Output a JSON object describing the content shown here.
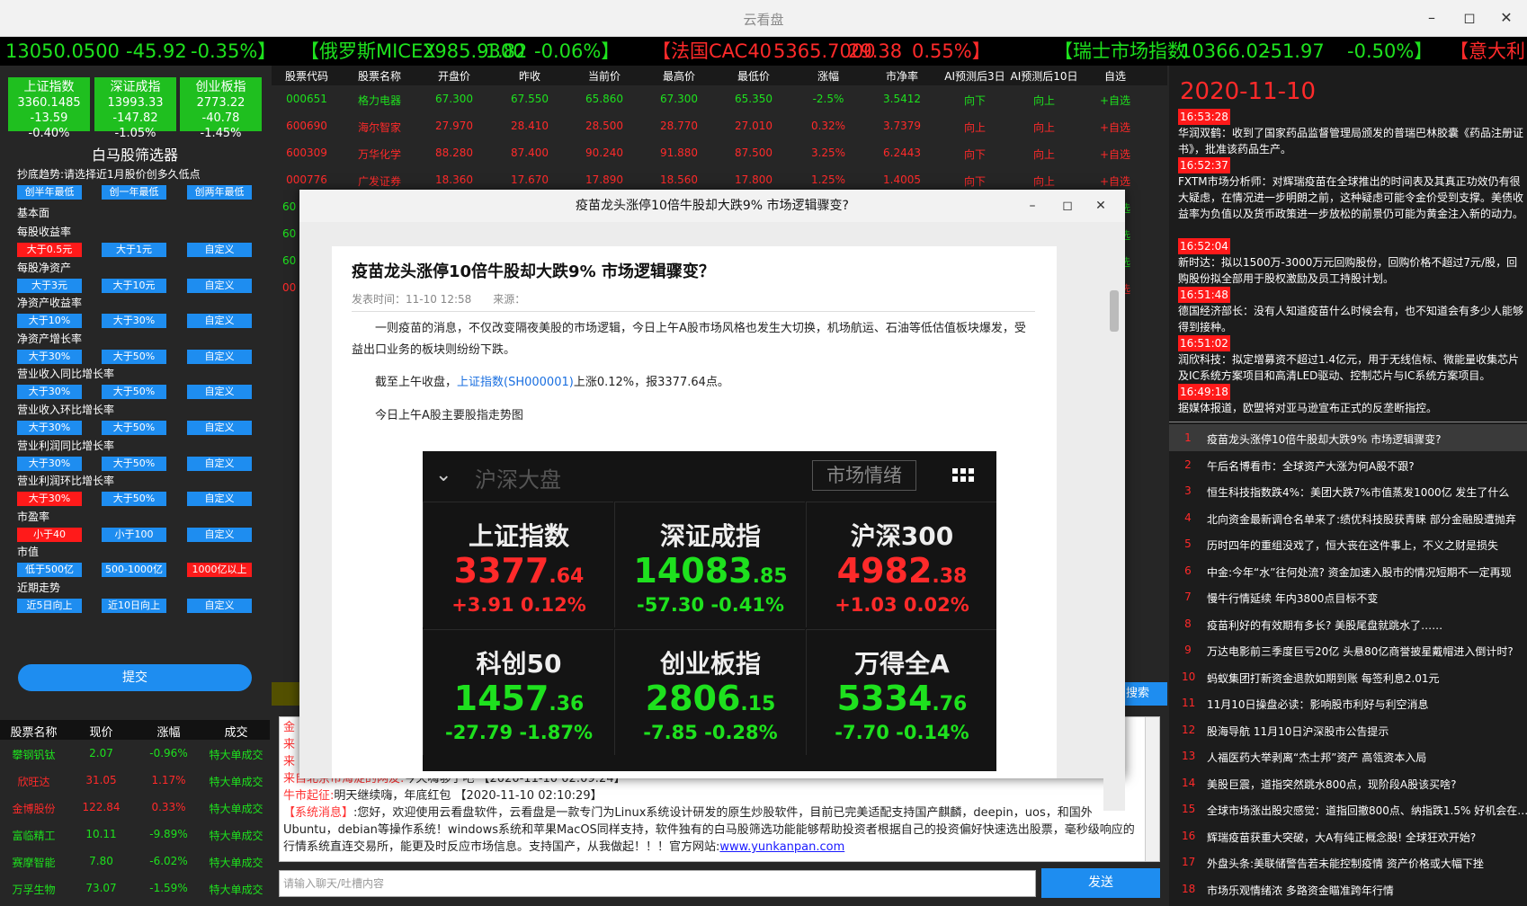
{
  "window": {
    "title": "云看盘"
  },
  "ticker": [
    {
      "text": "13050.0500",
      "color": "green"
    },
    {
      "text": "-45.92",
      "color": "green"
    },
    {
      "text": "-0.35%】",
      "color": "green"
    },
    {
      "text": "【俄罗斯MICEX",
      "color": "green"
    },
    {
      "text": "2985.9300",
      "color": "green"
    },
    {
      "text": "-1.82",
      "color": "green"
    },
    {
      "text": "-0.06%】",
      "color": "green"
    },
    {
      "text": "【法国CAC40",
      "color": "red"
    },
    {
      "text": "5365.7000",
      "color": "red"
    },
    {
      "text": "29.38",
      "color": "red"
    },
    {
      "text": "0.55%】",
      "color": "red"
    },
    {
      "text": "【瑞士市场指数",
      "color": "green"
    },
    {
      "text": "10366.02",
      "color": "green"
    },
    {
      "text": "-51.97",
      "color": "green"
    },
    {
      "text": "-0.50%】",
      "color": "green"
    },
    {
      "text": "【意大利",
      "color": "red"
    }
  ],
  "indices": [
    {
      "name": "上证指数",
      "value": "3360.1485",
      "change": "-13.59 -0.40%"
    },
    {
      "name": "深证成指",
      "value": "13993.33",
      "change": "-147.82 -1.05%"
    },
    {
      "name": "创业板指",
      "value": "2773.22",
      "change": "-40.78 -1.45%"
    }
  ],
  "screener": {
    "title": "白马股筛选器",
    "trend_label": "抄底趋势:请选择近1月股价创多久低点",
    "trend_buttons": [
      "创半年最低",
      "创一年最低",
      "创两年最低"
    ],
    "basic_label": "基本面",
    "groups": [
      {
        "label": "每股收益率",
        "buttons": [
          "大于0.5元",
          "大于1元",
          "自定义"
        ],
        "active": 0
      },
      {
        "label": "每股净资产",
        "buttons": [
          "大于3元",
          "大于10元",
          "自定义"
        ],
        "active": -1
      },
      {
        "label": "净资产收益率",
        "buttons": [
          "大于10%",
          "大于30%",
          "自定义"
        ],
        "active": -1
      },
      {
        "label": "净资产增长率",
        "buttons": [
          "大于30%",
          "大于50%",
          "自定义"
        ],
        "active": -1
      },
      {
        "label": "营业收入同比增长率",
        "buttons": [
          "大于30%",
          "大于50%",
          "自定义"
        ],
        "active": -1
      },
      {
        "label": "营业收入环比增长率",
        "buttons": [
          "大于30%",
          "大于50%",
          "自定义"
        ],
        "active": -1
      },
      {
        "label": "营业利润同比增长率",
        "buttons": [
          "大于30%",
          "大于50%",
          "自定义"
        ],
        "active": -1
      },
      {
        "label": "营业利润环比增长率",
        "buttons": [
          "大于30%",
          "大于50%",
          "自定义"
        ],
        "active": 0
      },
      {
        "label": "市盈率",
        "buttons": [
          "小于40",
          "小于100",
          "自定义"
        ],
        "active": 0
      },
      {
        "label": "市值",
        "buttons": [
          "低于500亿",
          "500-1000亿",
          "1000亿以上"
        ],
        "active": 2
      },
      {
        "label": "近期走势",
        "buttons": [
          "近5日向上",
          "近10日向上",
          "自定义"
        ],
        "active": -1
      }
    ],
    "submit": "提交"
  },
  "left_table": {
    "headers": [
      "股票名称",
      "现价",
      "涨幅",
      "成交"
    ],
    "rows": [
      {
        "name": "攀钢钒钛",
        "price": "2.07",
        "change": "-0.96%",
        "deal": "特大单成交",
        "color": "green"
      },
      {
        "name": "欣旺达",
        "price": "31.05",
        "change": "1.17%",
        "deal": "特大单成交",
        "color": "red"
      },
      {
        "name": "金博股份",
        "price": "122.84",
        "change": "0.33%",
        "deal": "特大单成交",
        "color": "red"
      },
      {
        "name": "富临精工",
        "price": "10.11",
        "change": "-9.89%",
        "deal": "特大单成交",
        "color": "green"
      },
      {
        "name": "赛摩智能",
        "price": "7.80",
        "change": "-6.02%",
        "deal": "特大单成交",
        "color": "green"
      },
      {
        "name": "万孚生物",
        "price": "73.07",
        "change": "-1.59%",
        "deal": "特大单成交",
        "color": "green"
      }
    ]
  },
  "grid": {
    "headers": [
      "股票代码",
      "股票名称",
      "开盘价",
      "昨收",
      "当前价",
      "最高价",
      "最低价",
      "涨幅",
      "市净率",
      "AI预测后3日",
      "AI预测后10日",
      "自选"
    ],
    "rows": [
      {
        "cells": [
          "000651",
          "格力电器",
          "67.300",
          "67.550",
          "65.860",
          "67.300",
          "65.350",
          "-2.5%",
          "3.5412",
          "向下",
          "向上",
          "+自选"
        ],
        "color": "green"
      },
      {
        "cells": [
          "600690",
          "海尔智家",
          "27.970",
          "28.410",
          "28.500",
          "28.770",
          "27.010",
          "0.32%",
          "3.7379",
          "向上",
          "向上",
          "+自选"
        ],
        "color": "red"
      },
      {
        "cells": [
          "600309",
          "万华化学",
          "88.280",
          "87.400",
          "90.240",
          "91.880",
          "87.500",
          "3.25%",
          "6.2443",
          "向下",
          "向上",
          "+自选"
        ],
        "color": "red"
      },
      {
        "cells": [
          "000776",
          "广发证券",
          "18.360",
          "17.670",
          "17.890",
          "18.560",
          "17.800",
          "1.25%",
          "1.4005",
          "向下",
          "向上",
          "+自选"
        ],
        "color": "red"
      }
    ],
    "partial_rows": [
      {
        "code": "60",
        "add": "+自选",
        "color": "green"
      },
      {
        "code": "60",
        "add": "+自选",
        "color": "green"
      },
      {
        "code": "60",
        "add": "+自选",
        "color": "green"
      },
      {
        "code": "00",
        "add": "+自选",
        "color": "red"
      }
    ],
    "search_label": "搜索"
  },
  "chat": {
    "partial_lines": [
      "金",
      "来",
      "来"
    ],
    "line1_prefix": "来自北京市海淀的网友:",
    "line1_text": "今天嗨够了吧 【2020-11-10 02:09:24】",
    "line2_prefix": "牛市起征:",
    "line2_text": "明天继续嗨，年底红包 【2020-11-10 02:10:29】",
    "sys_prefix": "【系统消息】",
    "sys_text": ":您好，欢迎使用云看盘软件，云看盘是一款专门为Linux系统设计研发的原生炒股软件，目前已完美适配支持国产麒麟，deepin，uos，和国外Ubuntu，debian等操作系统！windows系统和苹果MacOS同样支持，软件独有的白马股筛选功能能够帮助投资者根据自己的投资偏好快速选出股票，毫秒级响应的行情系统直连交易所，能更及时反应市场信息。支持国产，从我做起！！！官方网站:",
    "site": "www.yunkanpan.com",
    "input_placeholder": "请输入聊天/吐槽内容",
    "send": "发送"
  },
  "news": {
    "date": "2020-11-10",
    "items": [
      {
        "time": "16:53:28",
        "text": "华润双鹤：收到了国家药品监督管理局颁发的普瑞巴林胶囊《药品注册证书》，批准该药品生产。"
      },
      {
        "time": "16:52:37",
        "text": "FXTM市场分析师：对辉瑞疫苗在全球推出的时间表及其真正功效仍有很大疑虑，在情况进一步明朗之前，这种疑虑可能令金价受到支撑。美债收益率为负值以及货币政策进一步放松的前景仍可能为黄金注入新的动力。"
      },
      {
        "time": "16:52:04",
        "text": "新时达：拟以1500万-3000万元回购股份，回购价格不超过7元/股，回购股份拟全部用于股权激励及员工持股计划。"
      },
      {
        "time": "16:51:48",
        "text": "德国经济部长：没有人知道疫苗什么时候会有，也不知道会有多少人能够得到接种。"
      },
      {
        "time": "16:51:02",
        "text": "润欣科技：拟定增募资不超过1.4亿元，用于无线信标、微能量收集芯片及IC系统方案项目和高清LED驱动、控制芯片与IC系统方案项目。"
      },
      {
        "time": "16:49:18",
        "text": "据媒体报道，欧盟将对亚马逊宣布正式的反垄断指控。"
      }
    ]
  },
  "hot_list": [
    "疫苗龙头涨停10倍牛股却大跌9% 市场逻辑骤变?",
    "午后名博看市：全球资产大涨为何A股不跟?",
    "恒生科技指数跌4%：美团大跌7%市值蒸发1000亿 发生了什么",
    "北向资金最新调仓名单来了:绩优科技股获青睐 部分金融股遭抛弃",
    "历时四年的重组没戏了，恒大丧在这件事上，不义之财是损失",
    "中金:今年“水”往何处流? 资金加速入股市的情况短期不一定再现",
    "慢牛行情延续 年内3800点目标不变",
    "疫苗利好的有效期有多长? 美股尾盘就跳水了……",
    "万达电影前三季度巨亏20亿 头悬80亿商誉披星戴帽进入倒计时?",
    "蚂蚁集团打新资金退款如期到账 每签利息2.01元",
    "11月10日操盘必读：影响股市利好与利空消息",
    "股海导航 11月10日沪深股市公告提示",
    "人福医药大举剥离“杰士邦”资产 高瓴资本入局",
    "美股巨震，道指突然跳水800点，现阶段A股该买啥?",
    "全球市场涨出股灾感觉：道指回撤800点、纳指跌1.5% 好机会在……",
    "辉瑞疫苗获重大突破，大A有纯正概念股! 全球狂欢开始?",
    "外盘头条:美联储警告若未能控制疫情 资产价格或大幅下挫",
    "市场乐观情绪浓 多路资金瞄准跨年行情"
  ],
  "modal": {
    "title": "疫苗龙头涨停10倍牛股却大跌9% 市场逻辑骤变?",
    "article_title": "疫苗龙头涨停10倍牛股却大跌9% 市场逻辑骤变？",
    "meta": "发表时间：11-10 12:58　　来源：",
    "para1": "一则疫苗的消息，不仅改变隔夜美股的市场逻辑，今日上午A股市场风格也发生大切换，机场航运、石油等低估值板块爆发，受益出口业务的板块则纷纷下跌。",
    "para2_pre": "截至上午收盘，",
    "para2_link": "上证指数(SH000001)",
    "para2_post": "上涨0.12%，报3377.64点。",
    "para3": "今日上午A股主要股指走势图",
    "panel_title": "沪深大盘",
    "panel_mood": "市场情绪",
    "cells": [
      {
        "name": "上证指数",
        "int": "3377",
        "dec": ".64",
        "change": "+3.91  0.12%",
        "color": "red"
      },
      {
        "name": "深证成指",
        "int": "14083",
        "dec": ".85",
        "change": "-57.30  -0.41%",
        "color": "green"
      },
      {
        "name": "沪深300",
        "int": "4982",
        "dec": ".38",
        "change": "+1.03  0.02%",
        "color": "red"
      },
      {
        "name": "科创50",
        "int": "1457",
        "dec": ".36",
        "change": "-27.79  -1.87%",
        "color": "green"
      },
      {
        "name": "创业板指",
        "int": "2806",
        "dec": ".15",
        "change": "-7.85  -0.28%",
        "color": "green"
      },
      {
        "name": "万得全A",
        "int": "5334",
        "dec": ".76",
        "change": "-7.70  -0.14%",
        "color": "green"
      }
    ]
  },
  "colors": {
    "green": "#1ee11e",
    "red": "#ff2a2a",
    "accent": "#1e8df0",
    "index_bg": "#1fbf1f"
  }
}
